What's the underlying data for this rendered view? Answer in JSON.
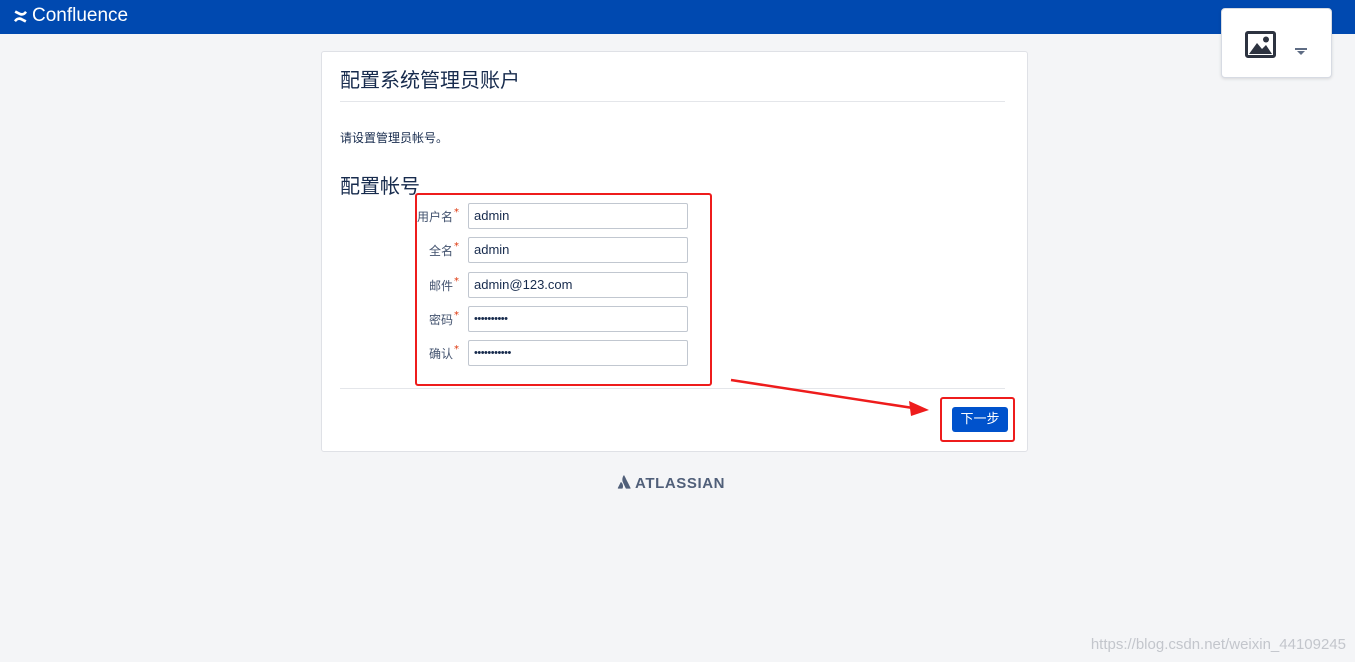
{
  "header": {
    "app_name": "Confluence",
    "background_color": "#0049b0",
    "logo_icon": "confluence-logo-icon"
  },
  "image_widget": {
    "icon": "image-icon",
    "dropdown_icon": "caret-down-icon"
  },
  "card": {
    "title": "配置系统管理员账户",
    "intro": "请设置管理员帐号。",
    "section_title": "配置帐号",
    "required_mark": "*",
    "fields": [
      {
        "label": "用户名",
        "value": "admin",
        "type": "text"
      },
      {
        "label": "全名",
        "value": "admin",
        "type": "text"
      },
      {
        "label": "邮件",
        "value": "admin@123.com",
        "type": "email"
      },
      {
        "label": "密码",
        "value": "••••••••••",
        "type": "password"
      },
      {
        "label": "确认",
        "value": "•••••••••••",
        "type": "password"
      }
    ],
    "next_button": "下一步",
    "button_color": "#0052cc"
  },
  "footer": {
    "logo_text": "ATLASSIAN",
    "logo_icon": "atlassian-logo-icon"
  },
  "annotation": {
    "color": "#ee1c1c"
  },
  "watermark": "https://blog.csdn.net/weixin_44109245"
}
